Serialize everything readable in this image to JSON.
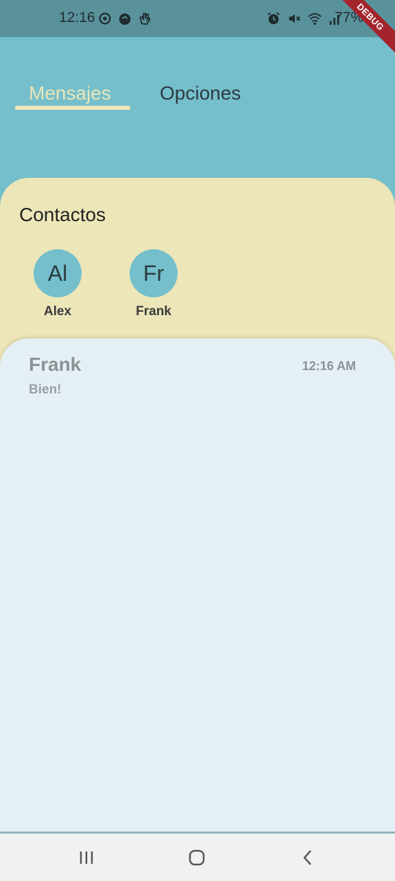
{
  "status_bar": {
    "time": "12:16",
    "battery": "77%",
    "left_icons": [
      "sync-icon",
      "app-icon",
      "hand-icon"
    ],
    "right_icons": [
      "alarm-icon",
      "mute-icon",
      "wifi-icon",
      "signal-icon"
    ]
  },
  "debug_banner": "DEBUG",
  "tabs": {
    "items": [
      {
        "label": "Mensajes",
        "active": true
      },
      {
        "label": "Opciones",
        "active": false
      }
    ]
  },
  "contacts": {
    "title": "Contactos",
    "items": [
      {
        "initials": "Al",
        "name": "Alex"
      },
      {
        "initials": "Fr",
        "name": "Frank"
      }
    ]
  },
  "messages": {
    "items": [
      {
        "sender": "Frank",
        "time": "12:16 AM",
        "preview": "Bien!"
      }
    ]
  },
  "bottom_nav": {
    "icons": [
      "recent-apps-icon",
      "home-icon",
      "back-icon"
    ]
  },
  "colors": {
    "background": "#74bfcb",
    "status_bar": "#5a929c",
    "accent": "#ece5b8",
    "contacts_bg": "#ede6b9",
    "messages_bg": "#e5f0f6",
    "avatar": "#74bfcb",
    "debug": "#a3242c"
  }
}
